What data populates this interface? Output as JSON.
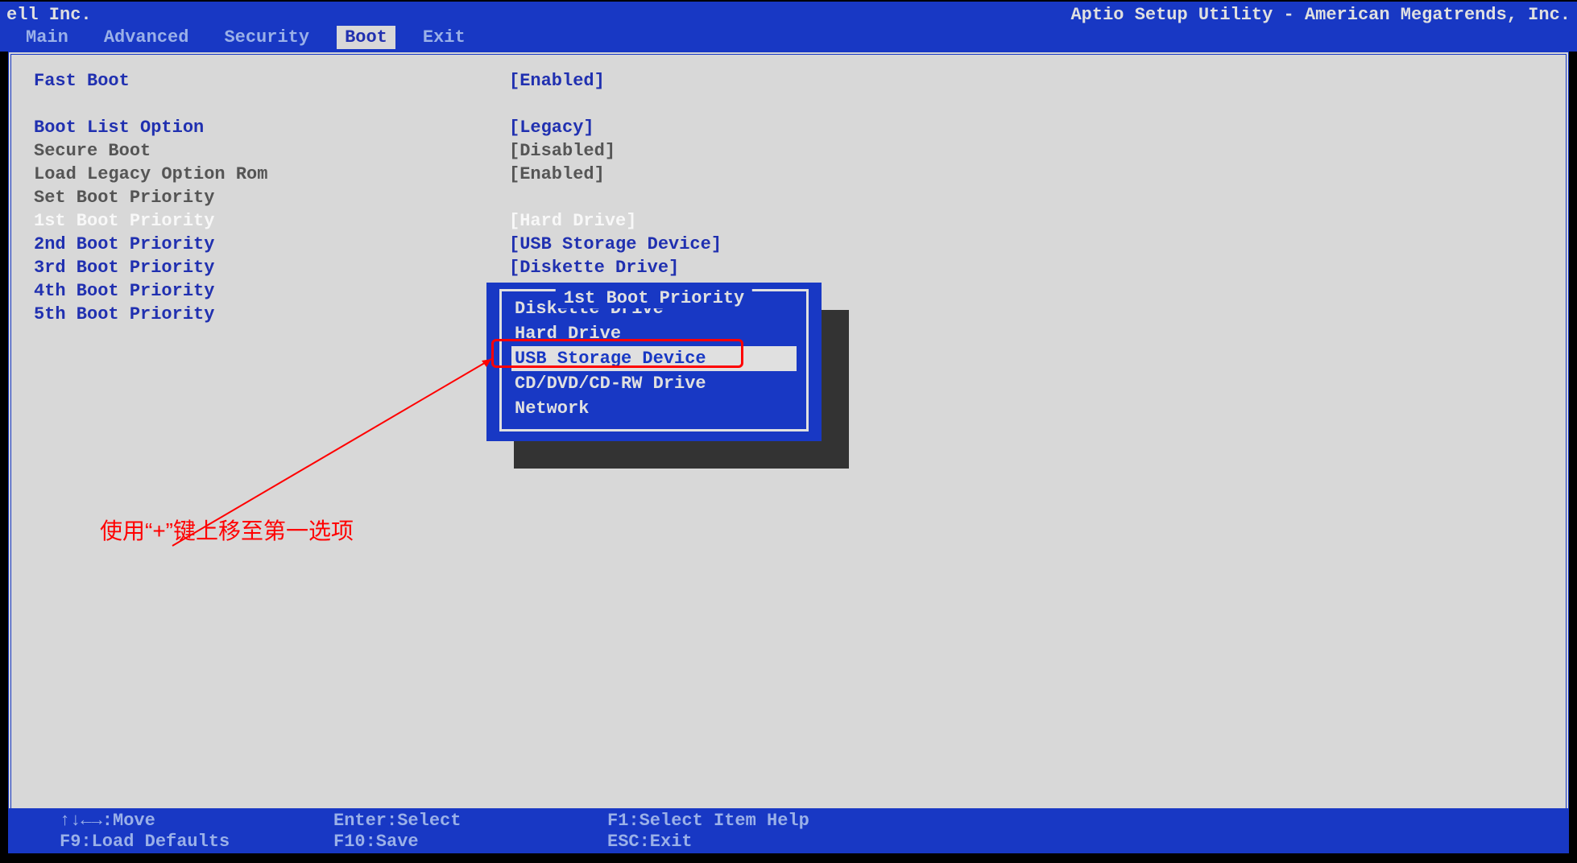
{
  "header": {
    "vendor_left": "ell Inc.",
    "vendor_right": "Aptio Setup Utility - American Megatrends, Inc."
  },
  "tabs": {
    "main": "Main",
    "advanced": "Advanced",
    "security": "Security",
    "boot": "Boot",
    "exit": "Exit",
    "active": "boot"
  },
  "boot_page": {
    "fast_boot": {
      "label": "Fast Boot",
      "value": "[Enabled]"
    },
    "boot_list_option": {
      "label": "Boot List Option",
      "value": "[Legacy]"
    },
    "secure_boot": {
      "label": "Secure Boot",
      "value": "[Disabled]"
    },
    "load_legacy_rom": {
      "label": "Load Legacy Option Rom",
      "value": "[Enabled]"
    },
    "set_boot_priority": {
      "label": "Set Boot Priority",
      "value": ""
    },
    "p1": {
      "label": "1st Boot Priority",
      "value": "[Hard Drive]"
    },
    "p2": {
      "label": "2nd Boot Priority",
      "value": "[USB Storage Device]"
    },
    "p3": {
      "label": "3rd Boot Priority",
      "value": "[Diskette Drive]"
    },
    "p4": {
      "label": "4th Boot Priority",
      "value": ""
    },
    "p5": {
      "label": "5th Boot Priority",
      "value": ""
    }
  },
  "popup": {
    "title": " 1st Boot Priority ",
    "items": {
      "diskette": "Diskette Drive",
      "hdd": "Hard Drive",
      "usb": "USB Storage Device",
      "cddvd": "CD/DVD/CD-RW Drive",
      "network": "Network"
    },
    "selected": "usb"
  },
  "annotation": {
    "text": "使用“+”键上移至第一选项"
  },
  "footer": {
    "move": "↑↓←→:Move",
    "enter": "Enter:Select",
    "f1": "F1:Select Item Help",
    "f9": "F9:Load Defaults",
    "f10": "F10:Save",
    "esc": "ESC:Exit"
  }
}
